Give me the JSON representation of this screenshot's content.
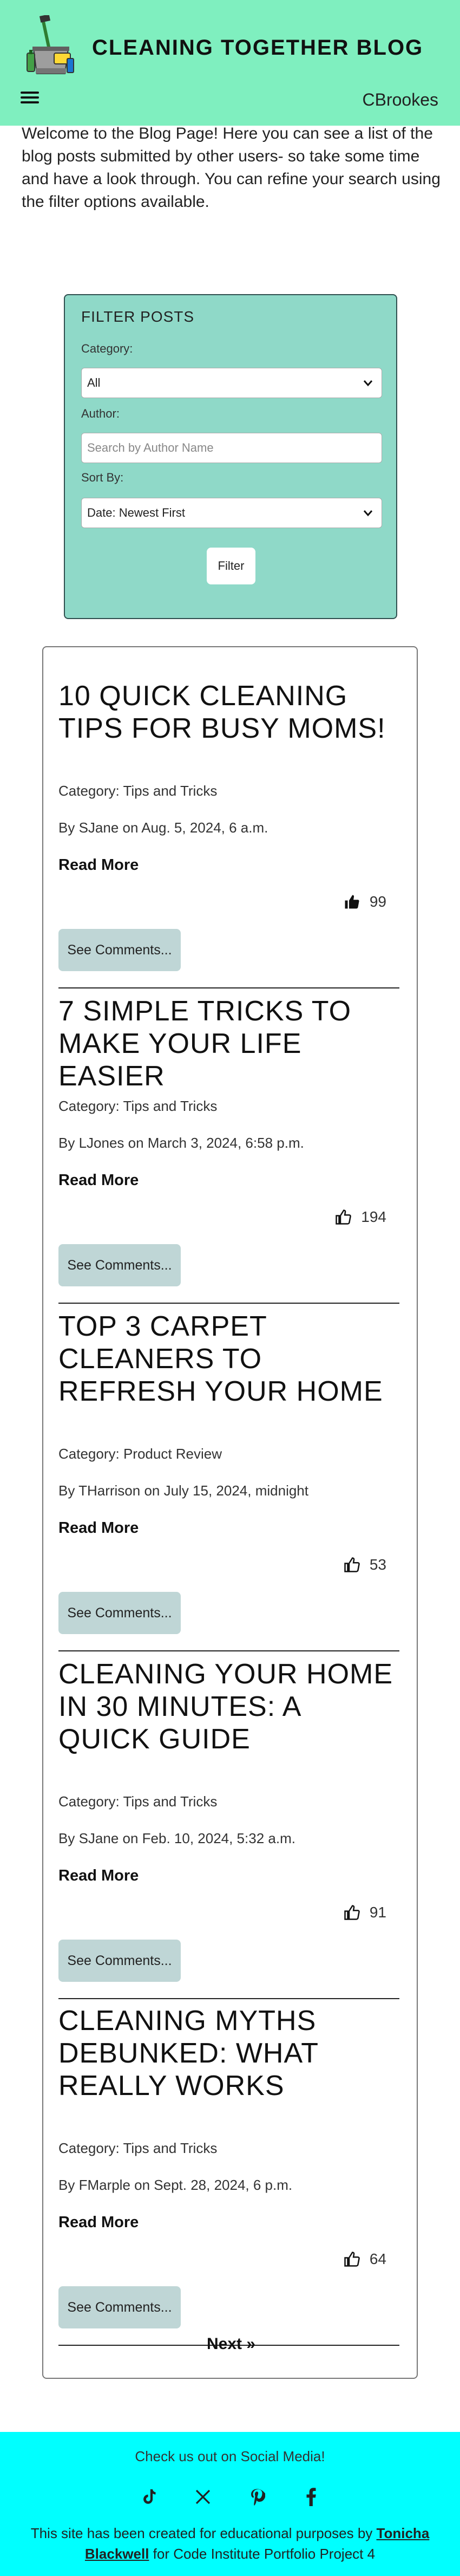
{
  "header": {
    "site_title": "CLEANING TOGETHER BLOG",
    "username": "CBrookes",
    "menu_icon": "hamburger-menu-icon"
  },
  "intro": {
    "text": "Welcome to the Blog Page! Here you can see a list of the blog posts submitted by other users- so take some time and have a look through. You can refine your search using the filter options available."
  },
  "filter": {
    "title": "FILTER POSTS",
    "category_label": "Category:",
    "category_value": "All",
    "author_label": "Author:",
    "author_placeholder": "Search by Author Name",
    "sort_label": "Sort By:",
    "sort_value": "Date: Newest First",
    "button_label": "Filter"
  },
  "posts": [
    {
      "title": "10 QUICK CLEANING TIPS FOR BUSY MOMS!",
      "category": "Category: Tips and Tricks",
      "byline": "By SJane on Aug. 5, 2024, 6 a.m.",
      "read_more": "Read More",
      "likes": "99",
      "liked": true,
      "comments_label": "See Comments..."
    },
    {
      "title": "7 SIMPLE TRICKS TO MAKE YOUR LIFE EASIER",
      "category": "Category: Tips and Tricks",
      "byline": "By LJones on March 3, 2024, 6:58 p.m.",
      "read_more": "Read More",
      "likes": "194",
      "liked": false,
      "comments_label": "See Comments..."
    },
    {
      "title": "TOP 3 CARPET CLEANERS TO REFRESH YOUR HOME",
      "category": "Category: Product Review",
      "byline": "By THarrison on July 15, 2024, midnight",
      "read_more": "Read More",
      "likes": "53",
      "liked": false,
      "comments_label": "See Comments..."
    },
    {
      "title": "CLEANING YOUR HOME IN 30 MINUTES: A QUICK GUIDE",
      "category": "Category: Tips and Tricks",
      "byline": "By SJane on Feb. 10, 2024, 5:32 a.m.",
      "read_more": "Read More",
      "likes": "91",
      "liked": false,
      "comments_label": "See Comments..."
    },
    {
      "title": "CLEANING MYTHS DEBUNKED: WHAT REALLY WORKS",
      "category": "Category: Tips and Tricks",
      "byline": "By FMarple on Sept. 28, 2024, 6 p.m.",
      "read_more": "Read More",
      "likes": "64",
      "liked": false,
      "comments_label": "See Comments..."
    }
  ],
  "pagination": {
    "next_label": "Next »"
  },
  "footer": {
    "follow_text": "Check us out on Social Media!",
    "socials": [
      "tiktok-icon",
      "x-twitter-icon",
      "pinterest-icon",
      "facebook-icon"
    ],
    "credit_prefix": "This site has been created for educational purposes by ",
    "credit_name": "Tonicha Blackwell",
    "credit_suffix": " for Code Institute Portfolio Project 4"
  },
  "colors": {
    "header_bg": "#7fefbf",
    "filter_bg": "#8fd9c8",
    "button_bg": "#bfd6d6",
    "footer_bg": "#00ffff"
  }
}
